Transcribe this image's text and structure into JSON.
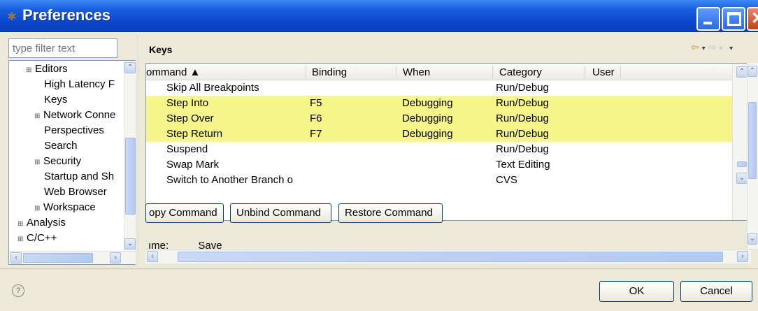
{
  "window": {
    "title": "Preferences"
  },
  "filter": {
    "placeholder": "type filter text"
  },
  "tree": {
    "items": [
      {
        "label": "Editors",
        "expander": "⊞"
      },
      {
        "label": "High Latency F",
        "expander": ""
      },
      {
        "label": "Keys",
        "expander": ""
      },
      {
        "label": "Network Conne",
        "expander": "⊞"
      },
      {
        "label": "Perspectives",
        "expander": ""
      },
      {
        "label": "Search",
        "expander": ""
      },
      {
        "label": "Security",
        "expander": "⊞"
      },
      {
        "label": "Startup and Sh",
        "expander": ""
      },
      {
        "label": "Web Browser",
        "expander": ""
      },
      {
        "label": "Workspace",
        "expander": "⊞"
      },
      {
        "label": "Analysis",
        "expander": "⊞"
      },
      {
        "label": "C/C++",
        "expander": "⊞"
      }
    ]
  },
  "page": {
    "title": "Keys"
  },
  "table": {
    "headers": [
      "Command",
      "Binding",
      "When",
      "Category",
      "User"
    ],
    "header_first_display": "ommand ▲",
    "rows": [
      {
        "command": "Skip All Breakpoints",
        "binding": "",
        "when": "",
        "category": "Run/Debug",
        "highlighted": false
      },
      {
        "command": "Step Into",
        "binding": "F5",
        "when": "Debugging",
        "category": "Run/Debug",
        "highlighted": true
      },
      {
        "command": "Step Over",
        "binding": "F6",
        "when": "Debugging",
        "category": "Run/Debug",
        "highlighted": true
      },
      {
        "command": "Step Return",
        "binding": "F7",
        "when": "Debugging",
        "category": "Run/Debug",
        "highlighted": true
      },
      {
        "command": "Suspend",
        "binding": "",
        "when": "",
        "category": "Run/Debug",
        "highlighted": false
      },
      {
        "command": "Swap Mark",
        "binding": "",
        "when": "",
        "category": "Text Editing",
        "highlighted": false
      },
      {
        "command": "Switch to Another Branch o",
        "binding": "",
        "when": "",
        "category": "CVS",
        "highlighted": false
      }
    ]
  },
  "actions": {
    "copy": "opy Command",
    "unbind": "Unbind Command",
    "restore": "Restore Command"
  },
  "details": {
    "name_label": "ıme:",
    "name_value": "Save"
  },
  "dialog": {
    "ok": "OK",
    "cancel": "Cancel",
    "help": "?"
  },
  "colors": {
    "highlight": "#f5f589",
    "titlebar": "#0b47cc"
  }
}
